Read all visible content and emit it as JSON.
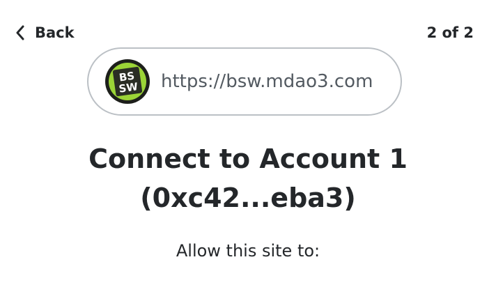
{
  "header": {
    "back_label": "Back",
    "page_counter": "2 of 2",
    "back_icon": "chevron-left-icon"
  },
  "site": {
    "url": "https://bsw.mdao3.com",
    "icon": "site-logo-icon",
    "icon_text_top": "BS",
    "icon_text_bottom": "SW",
    "icon_accent": "#9bd437"
  },
  "connect": {
    "title_line1": "Connect to Account 1",
    "title_line2": "(0xc42...eba3)",
    "subtitle": "Allow this site to:"
  },
  "colors": {
    "text": "#24272a",
    "url_text": "#535a61",
    "pill_border": "#bbc0c5"
  }
}
